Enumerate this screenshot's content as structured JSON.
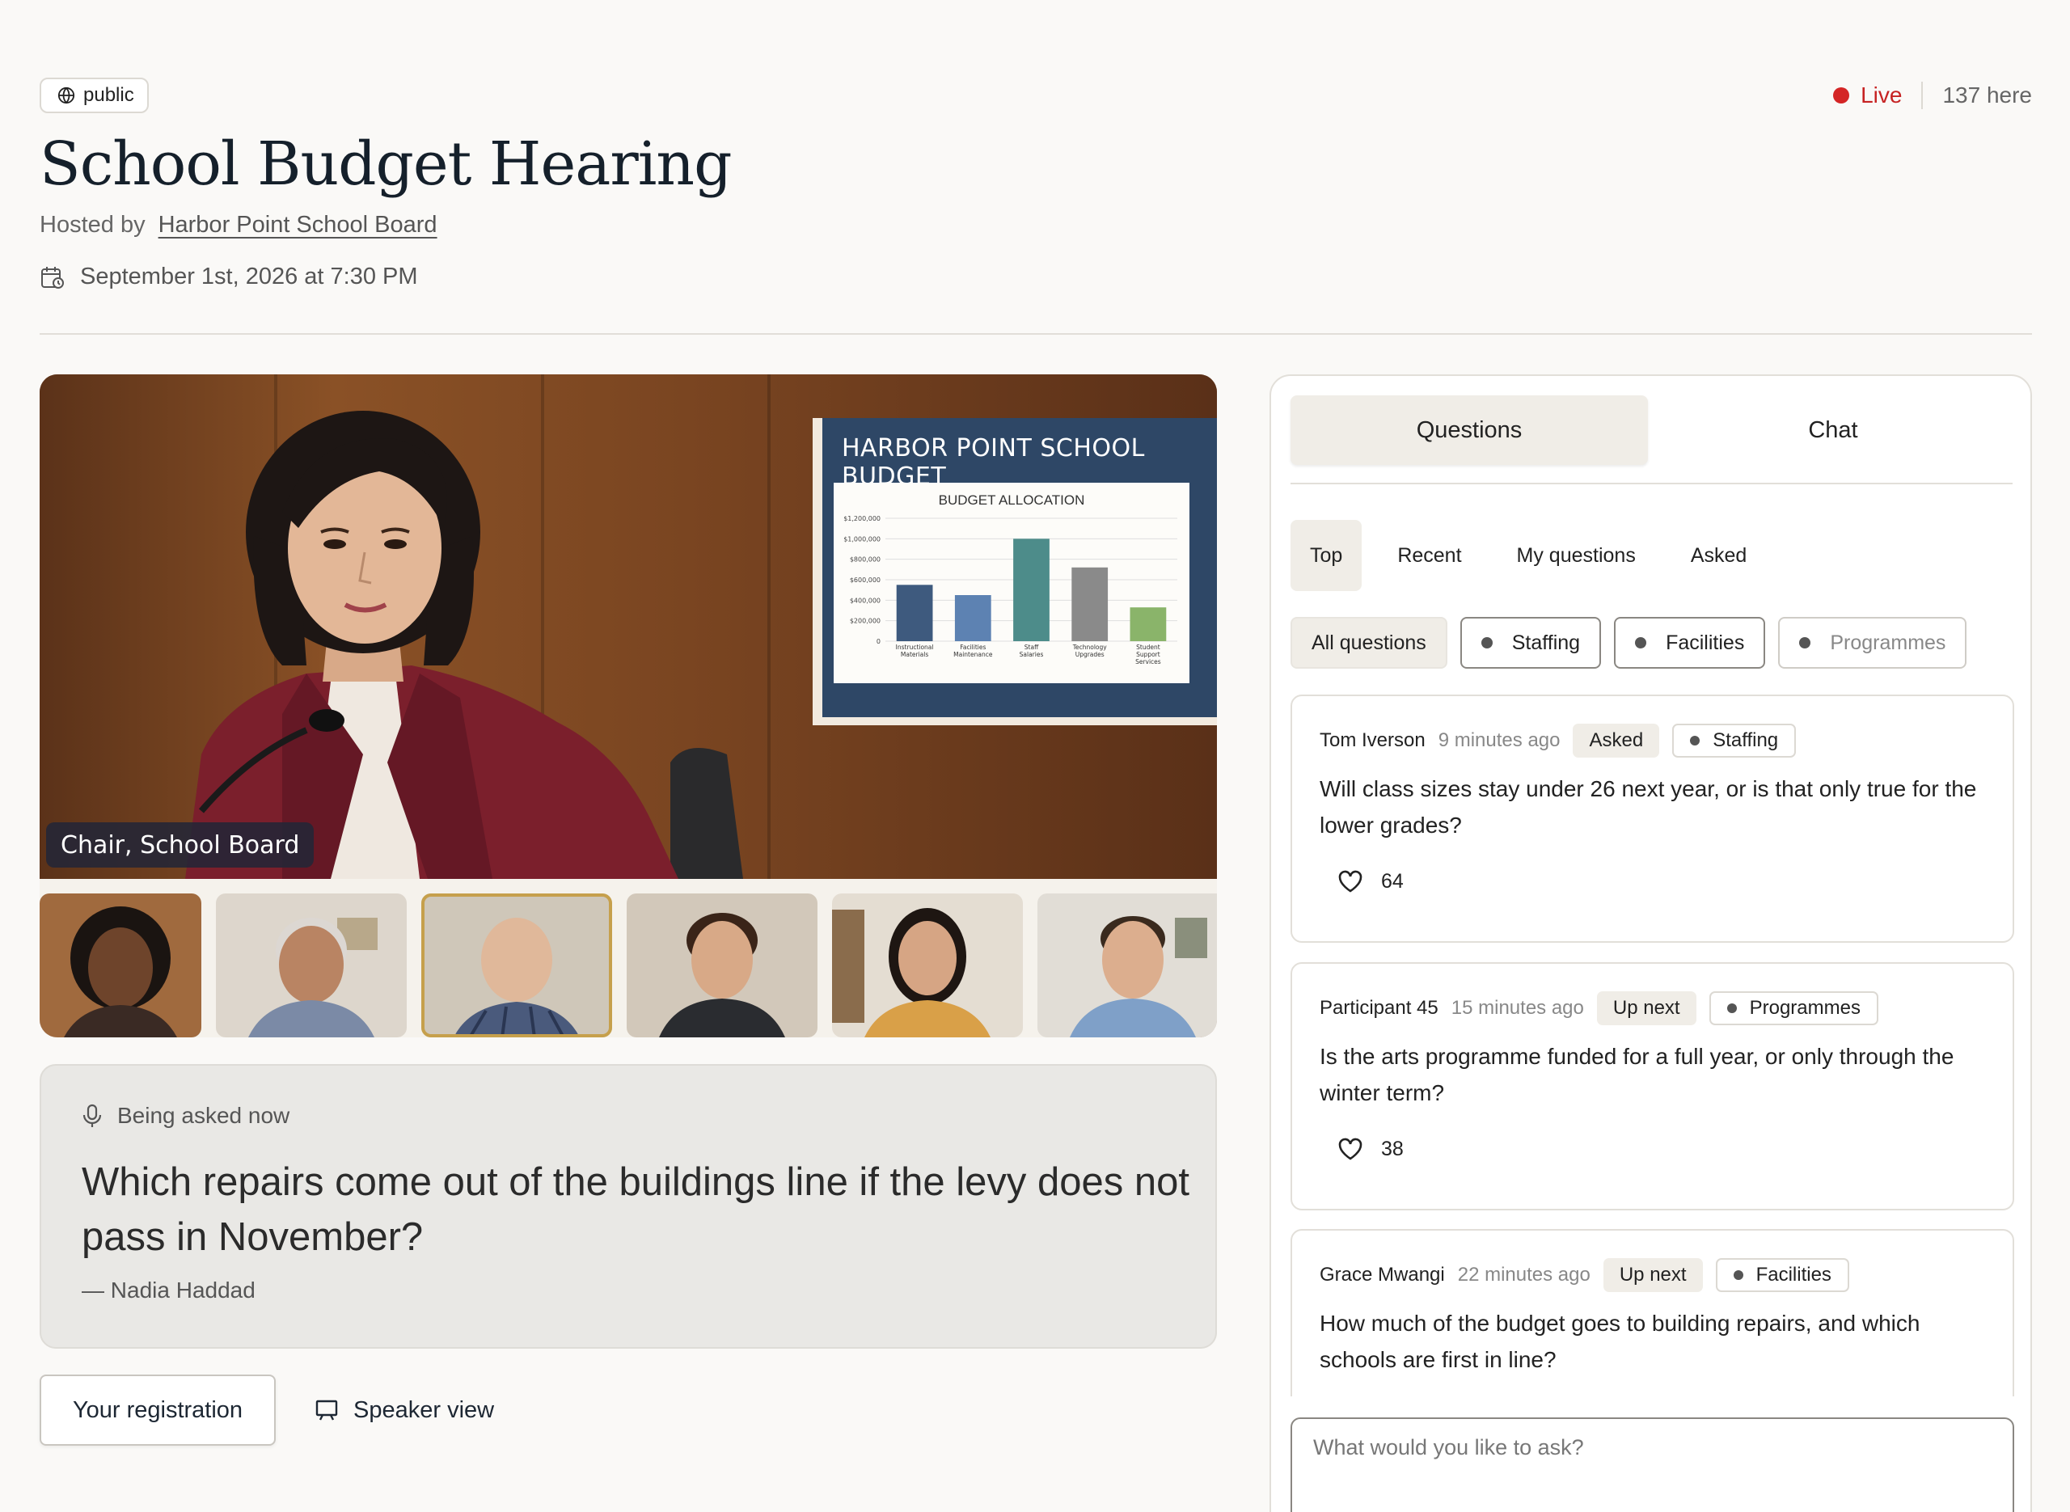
{
  "header": {
    "visibility": "public",
    "live_label": "Live",
    "attendance": "137 here",
    "title": "School Budget Hearing",
    "hosted_by_label": "Hosted by",
    "host": "Harbor Point School Board",
    "datetime": "September 1st, 2026 at 7:30 PM"
  },
  "video": {
    "slide_title": "HARBOR POINT SCHOOL BUDGET",
    "slide_chart": {
      "title": "BUDGET ALLOCATION",
      "categories": [
        "Instructional Materials",
        "Facilities Maintenance",
        "Staff Salaries",
        "Technology Upgrades",
        "Student Support Services"
      ],
      "values": [
        550000,
        450000,
        1000000,
        720000,
        330000
      ],
      "ylim": [
        0,
        1200000
      ],
      "yticks": [
        "0",
        "$200,000",
        "$400,000",
        "$600,000",
        "$800,000",
        "$1,000,000",
        "$1,200,000"
      ],
      "colors": [
        "#3e5a7e",
        "#5d82b2",
        "#4d8c8a",
        "#8a8a8a",
        "#8ab46a"
      ]
    },
    "caption": "Chair, School Board",
    "participant_count": 6,
    "active_thumbnail": 2
  },
  "asked_now": {
    "label": "Being asked now",
    "question": "Which repairs come out of the buildings line if the levy does not pass in November?",
    "author": "— Nadia Haddad"
  },
  "actions": {
    "registration": "Your registration",
    "speaker_view": "Speaker view"
  },
  "side": {
    "tabs": [
      "Questions",
      "Chat"
    ],
    "sort": [
      "Top",
      "Recent",
      "My questions",
      "Asked"
    ],
    "filters": [
      "All questions",
      "Staffing",
      "Facilities",
      "Programmes"
    ],
    "questions": [
      {
        "author": "Tom Iverson",
        "time": "9 minutes ago",
        "state": "Asked",
        "category": "Staffing",
        "text": "Will class sizes stay under 26 next year, or is that only true for the lower grades?",
        "likes": "64"
      },
      {
        "author": "Participant 45",
        "time": "15 minutes ago",
        "state": "Up next",
        "category": "Programmes",
        "text": "Is the arts programme funded for a full year, or only through the winter term?",
        "likes": "38"
      },
      {
        "author": "Grace Mwangi",
        "time": "22 minutes ago",
        "state": "Up next",
        "category": "Facilities",
        "text": "How much of the budget goes to building repairs, and which schools are first in line?",
        "likes": ""
      }
    ],
    "ask_placeholder": "What would you like to ask?"
  }
}
